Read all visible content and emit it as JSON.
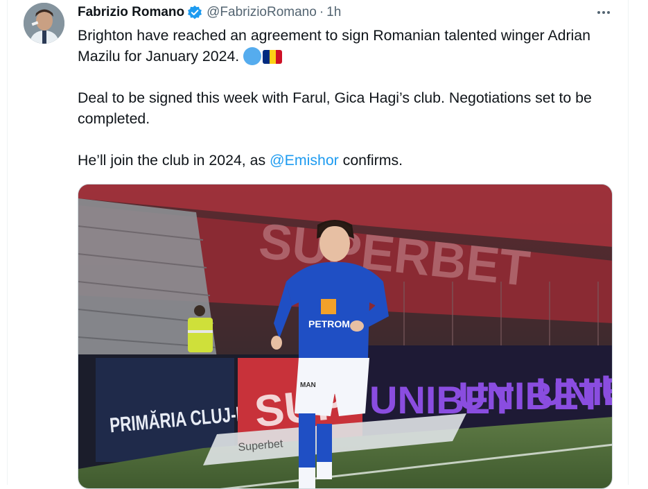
{
  "tweet": {
    "author_name": "Fabrizio Romano",
    "handle": "@FabrizioRomano",
    "separator": "·",
    "time": "1h",
    "paragraph1": "Brighton have reached an agreement to sign Romanian talented winger Adrian Mazilu for January 2024.",
    "paragraph2": "Deal to be signed this week with Farul, Gica Hagi’s club. Negotiations set to be completed.",
    "paragraph3_before": "He’ll join the club in 2024, as ",
    "mention": "@Emishor",
    "paragraph3_after": " confirms.",
    "flag_colors": [
      "#002b7f",
      "#fcd116",
      "#ce1126"
    ]
  },
  "media": {
    "stand_text": "SUPERBET",
    "banner_left": "PRIMĂRIA CLUJ-NAPOCA",
    "banner_mid": "SUP",
    "banner_unibet": [
      "UNIBET",
      "UNIBET",
      "UNIBET",
      "U"
    ],
    "jersey_sponsor": "PETROM",
    "shorts_text": "MAN",
    "ad_boards": "Superbet",
    "colors": {
      "kit_blue": "#1f4fc4",
      "unibet_purple": "#8a4de0",
      "stand_red": "#b22a35",
      "pitch_green": "#4f6a3a"
    }
  }
}
